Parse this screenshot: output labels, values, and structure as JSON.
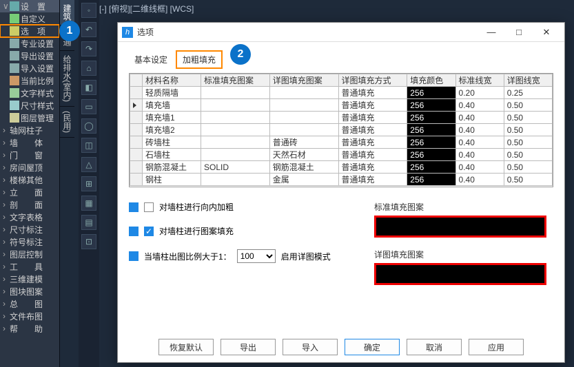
{
  "top_status": "[-] [俯视][二维线框] [WCS]",
  "sidebar": {
    "items": [
      {
        "label": "设　置",
        "chev": "∨",
        "icon": "#6aa",
        "header": true
      },
      {
        "label": "自定义",
        "chev": "",
        "icon": "#7c7"
      },
      {
        "label": "选　项",
        "chev": "",
        "icon": "#cc6",
        "highlight": true
      },
      {
        "label": "专业设置",
        "chev": "",
        "icon": "#8aa"
      },
      {
        "label": "导出设置",
        "chev": "",
        "icon": "#8aa"
      },
      {
        "label": "导入设置",
        "chev": "",
        "icon": "#8aa"
      },
      {
        "label": "当前比例",
        "chev": "",
        "icon": "#c96"
      },
      {
        "label": "文字样式",
        "chev": "",
        "icon": "#9c9"
      },
      {
        "label": "尺寸样式",
        "chev": "",
        "icon": "#9cc"
      },
      {
        "label": "图层管理",
        "chev": "",
        "icon": "#cc9"
      },
      {
        "label": "轴网柱子",
        "chev": "›"
      },
      {
        "label": "墙　　体",
        "chev": "›"
      },
      {
        "label": "门　　窗",
        "chev": "›"
      },
      {
        "label": "房间屋顶",
        "chev": "›"
      },
      {
        "label": "楼梯其他",
        "chev": "›"
      },
      {
        "label": "立　　面",
        "chev": "›"
      },
      {
        "label": "剖　　面",
        "chev": "›"
      },
      {
        "label": "文字表格",
        "chev": "›"
      },
      {
        "label": "尺寸标注",
        "chev": "›"
      },
      {
        "label": "符号标注",
        "chev": "›"
      },
      {
        "label": "图层控制",
        "chev": "›"
      },
      {
        "label": "工　　具",
        "chev": "›"
      },
      {
        "label": "三维建模",
        "chev": "›"
      },
      {
        "label": "图块图案",
        "chev": "›"
      },
      {
        "label": "总　　图",
        "chev": "›"
      },
      {
        "label": "文件布图",
        "chev": "›"
      },
      {
        "label": "帮　　助",
        "chev": "›"
      }
    ]
  },
  "vtabs": [
    "建筑",
    "暖通",
    "给排水(室内)",
    "(民用)"
  ],
  "callouts": {
    "c1": "1",
    "c2": "2"
  },
  "dialog": {
    "title": "选项",
    "tabs": {
      "basic": "基本设定",
      "bold": "加粗填充"
    },
    "table": {
      "headers": [
        "材料名称",
        "标准填充图案",
        "详图填充图案",
        "详图填充方式",
        "填充颜色",
        "标准线宽",
        "详图线宽"
      ],
      "rows": [
        {
          "name": "轻质隔墙",
          "std": "",
          "det": "",
          "mode": "普通填充",
          "color": "256",
          "w1": "0.20",
          "w2": "0.25"
        },
        {
          "name": "填充墙",
          "std": "",
          "det": "",
          "mode": "普通填充",
          "color": "256",
          "w1": "0.40",
          "w2": "0.50",
          "active": true
        },
        {
          "name": "填充墙1",
          "std": "",
          "det": "",
          "mode": "普通填充",
          "color": "256",
          "w1": "0.40",
          "w2": "0.50"
        },
        {
          "name": "填充墙2",
          "std": "",
          "det": "",
          "mode": "普通填充",
          "color": "256",
          "w1": "0.40",
          "w2": "0.50"
        },
        {
          "name": "砖墙柱",
          "std": "",
          "det": "普通砖",
          "mode": "普通填充",
          "color": "256",
          "w1": "0.40",
          "w2": "0.50"
        },
        {
          "name": "石墙柱",
          "std": "",
          "det": "天然石材",
          "mode": "普通填充",
          "color": "256",
          "w1": "0.40",
          "w2": "0.50"
        },
        {
          "name": "钢筋混凝土",
          "std": "SOLID",
          "det": "钢筋混凝土",
          "mode": "普通填充",
          "color": "256",
          "w1": "0.40",
          "w2": "0.50"
        },
        {
          "name": "钢柱",
          "std": "",
          "det": "金属",
          "mode": "普通填充",
          "color": "256",
          "w1": "0.40",
          "w2": "0.50"
        }
      ]
    },
    "opts": {
      "inner_bold": "对墙柱进行向内加粗",
      "pattern_fill": "对墙柱进行图案填充",
      "scale_prefix": "当墙柱出图比例大于1：",
      "scale_value": "100",
      "scale_suffix": "启用详图模式",
      "std_label": "标准填充图案",
      "det_label": "详图填充图案"
    },
    "buttons": {
      "restore": "恢复默认",
      "export": "导出",
      "import": "导入",
      "ok": "确定",
      "cancel": "取消",
      "apply": "应用"
    }
  }
}
